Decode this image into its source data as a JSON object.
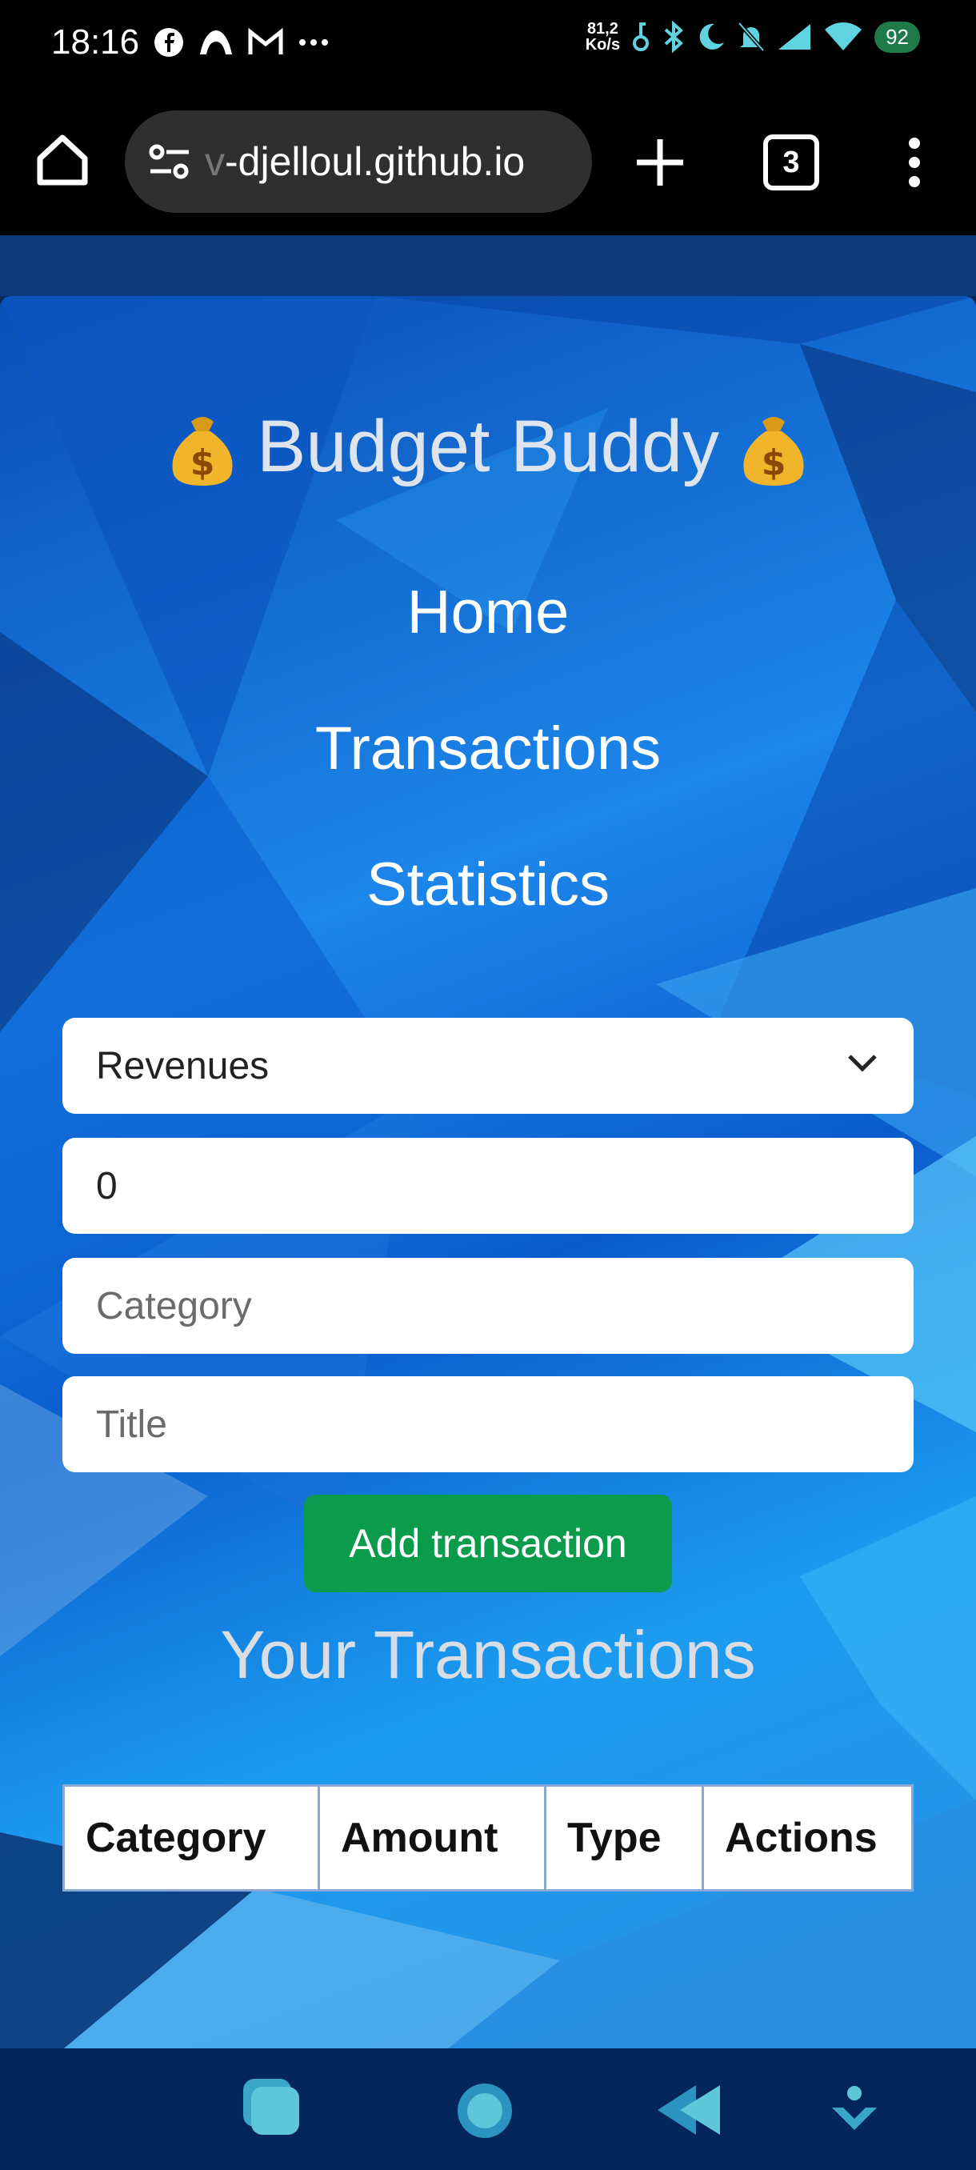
{
  "status_bar": {
    "time": "18:16",
    "net_speed_value": "81,2",
    "net_speed_unit": "Ko/s",
    "battery": "92"
  },
  "browser": {
    "url_faded": "v",
    "url": "-djelloul.github.io",
    "tab_count": "3"
  },
  "app": {
    "title": "Budget Buddy",
    "title_emoji": "💰",
    "nav": [
      "Home",
      "Transactions",
      "Statistics"
    ],
    "form": {
      "type_select": "Revenues",
      "amount_value": "0",
      "category_placeholder": "Category",
      "title_placeholder": "Title",
      "submit_label": "Add transaction"
    },
    "transactions": {
      "heading": "Your Transactions",
      "columns": [
        "Category",
        "Amount",
        "Type",
        "Actions"
      ]
    }
  },
  "colors": {
    "accent_button": "#0b9b4c",
    "battery_badge": "#1f7a4a",
    "background_blue": "#0a5ccc"
  }
}
